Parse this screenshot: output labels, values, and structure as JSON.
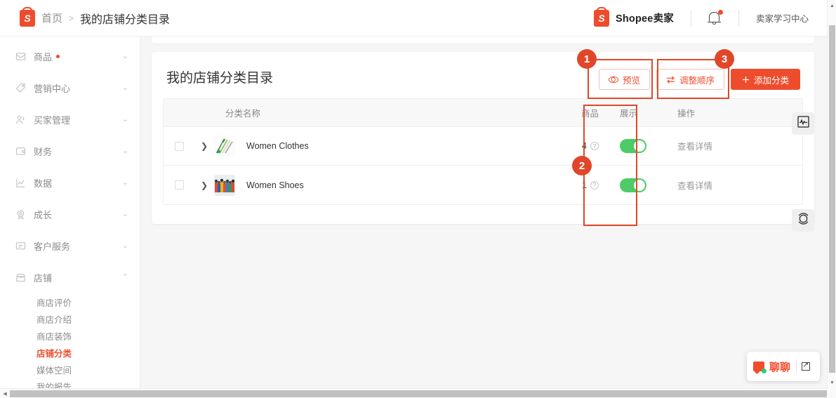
{
  "header": {
    "logo_icon": "shopee-bag-icon",
    "breadcrumb_home": "首页",
    "breadcrumb_separator": ">",
    "breadcrumb_current": "我的店铺分类目录",
    "seller_logo_icon": "shopee-bag-icon",
    "seller_name": "Shopee卖家",
    "bell_icon": "notification-bell-icon",
    "learning_center": "卖家学习中心"
  },
  "sidebar": {
    "items": [
      {
        "label": "商品",
        "icon": "box-icon",
        "chevron": "⌄",
        "has_dot": true,
        "expanded": false
      },
      {
        "label": "营销中心",
        "icon": "tag-icon",
        "chevron": "⌄",
        "has_dot": false,
        "expanded": false
      },
      {
        "label": "买家管理",
        "icon": "users-icon",
        "chevron": "⌄",
        "has_dot": false,
        "expanded": false
      },
      {
        "label": "财务",
        "icon": "wallet-icon",
        "chevron": "⌄",
        "has_dot": false,
        "expanded": false
      },
      {
        "label": "数据",
        "icon": "chart-line-icon",
        "chevron": "⌄",
        "has_dot": false,
        "expanded": false
      },
      {
        "label": "成长",
        "icon": "medal-icon",
        "chevron": "⌄",
        "has_dot": false,
        "expanded": false
      },
      {
        "label": "客户服务",
        "icon": "chat-icon",
        "chevron": "⌄",
        "has_dot": false,
        "expanded": false
      },
      {
        "label": "店铺",
        "icon": "shop-icon",
        "chevron": "⌃",
        "has_dot": false,
        "expanded": true
      }
    ],
    "shop_subitems": [
      {
        "label": "商店评价",
        "active": false
      },
      {
        "label": "商店介绍",
        "active": false
      },
      {
        "label": "商店装饰",
        "active": false
      },
      {
        "label": "店铺分类",
        "active": true
      },
      {
        "label": "媒体空间",
        "active": false
      },
      {
        "label": "我的报告",
        "active": false
      }
    ]
  },
  "main": {
    "page_title": "我的店铺分类目录",
    "buttons": {
      "preview": "预览",
      "preview_icon": "eye-icon",
      "reorder": "调整顺序",
      "reorder_icon": "swap-arrows-icon",
      "add_category": "添加分类",
      "add_icon": "plus-icon"
    },
    "table": {
      "columns": [
        "分类名称",
        "商品",
        "展示",
        "操作"
      ],
      "rows": [
        {
          "checkbox_checked": false,
          "expand_icon": "chevron-right-icon",
          "thumbnail": "women-clothes-thumb",
          "name": "Women Clothes",
          "count": "4",
          "count_help_icon": "question-mark-icon",
          "display_on": true,
          "action": "查看详情"
        },
        {
          "checkbox_checked": false,
          "expand_icon": "chevron-right-icon",
          "thumbnail": "women-shoes-thumb",
          "name": "Women Shoes",
          "count": "1",
          "count_help_icon": "question-mark-icon",
          "display_on": true,
          "action": "查看详情"
        }
      ]
    }
  },
  "annotations": [
    {
      "number": "1",
      "target": "preview-button"
    },
    {
      "number": "2",
      "target": "display-toggle-column"
    },
    {
      "number": "3",
      "target": "reorder-button"
    }
  ],
  "floating": {
    "analytics_icon": "pulse-chart-icon",
    "headset_icon": "headset-support-icon",
    "chat_icon": "chat-bubble-icon",
    "chat_label": "聊聊",
    "popout_icon": "popout-arrow-icon"
  },
  "colors": {
    "brand": "#ee4d2d",
    "annotation": "#e0472a",
    "toggle_on": "#4ccb66",
    "page_bg": "#f6f6f6"
  },
  "scrollbars": {
    "vertical_up": "▲",
    "vertical_down": "▼",
    "horizontal_left": "◀"
  }
}
